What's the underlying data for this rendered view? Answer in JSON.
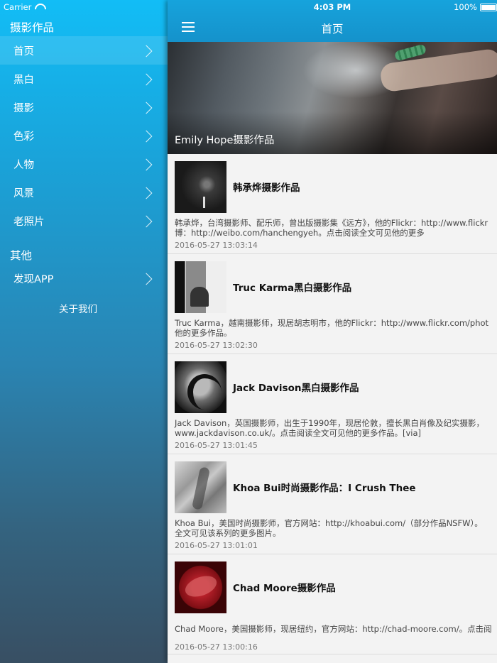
{
  "status_bar": {
    "carrier": "Carrier",
    "time": "4:03 PM",
    "battery": "100%"
  },
  "sidebar": {
    "section_title": "摄影作品",
    "items": [
      {
        "label": "首页"
      },
      {
        "label": "黑白"
      },
      {
        "label": "摄影"
      },
      {
        "label": "色彩"
      },
      {
        "label": "人物"
      },
      {
        "label": "风景"
      },
      {
        "label": "老照片"
      }
    ],
    "other_title": "其他",
    "other_items": [
      {
        "label": "发现APP"
      }
    ],
    "about": "关于我们"
  },
  "header": {
    "title": "首页"
  },
  "hero": {
    "caption": "Emily Hope摄影作品"
  },
  "articles": [
    {
      "title": "韩承烨摄影作品",
      "desc_line1": "韩承烨，台湾摄影师、配乐师，曾出版摄影集《远方》，他的Flickr：http://www.flickr",
      "desc_line2": "博：http://weibo.com/hanchengyeh。点击阅读全文可见他的更多",
      "date": "2016-05-27 13:03:14"
    },
    {
      "title": "Truc Karma黑白摄影作品",
      "desc_line1": "Truc Karma，越南摄影师，现居胡志明市，他的Flickr：http://www.flickr.com/phot",
      "desc_line2": "他的更多作品。",
      "date": "2016-05-27 13:02:30"
    },
    {
      "title": "Jack Davison黑白摄影作品",
      "desc_line1": "Jack Davison，英国摄影师，出生于1990年，现居伦敦，擅长黑白肖像及纪实摄影，",
      "desc_line2": "www.jackdavison.co.uk/。点击阅读全文可见他的更多作品。[via]",
      "date": "2016-05-27 13:01:45"
    },
    {
      "title": "Khoa Bui时尚摄影作品：I Crush Thee",
      "desc_line1": "Khoa Bui，美国时尚摄影师，官方网站：http://khoabui.com/（部分作品NSFW）。",
      "desc_line2": "全文可见该系列的更多图片。",
      "date": "2016-05-27 13:01:01"
    },
    {
      "title": "Chad Moore摄影作品",
      "desc_line1": "Chad Moore，美国摄影师，现居纽约，官方网站：http://chad-moore.com/。点击阅",
      "desc_line2": "",
      "date": "2016-05-27 13:00:16"
    }
  ],
  "colors": {
    "accent": "#1592cb",
    "sidebar_top": "#12bdf6",
    "sidebar_bottom": "#384f63"
  }
}
